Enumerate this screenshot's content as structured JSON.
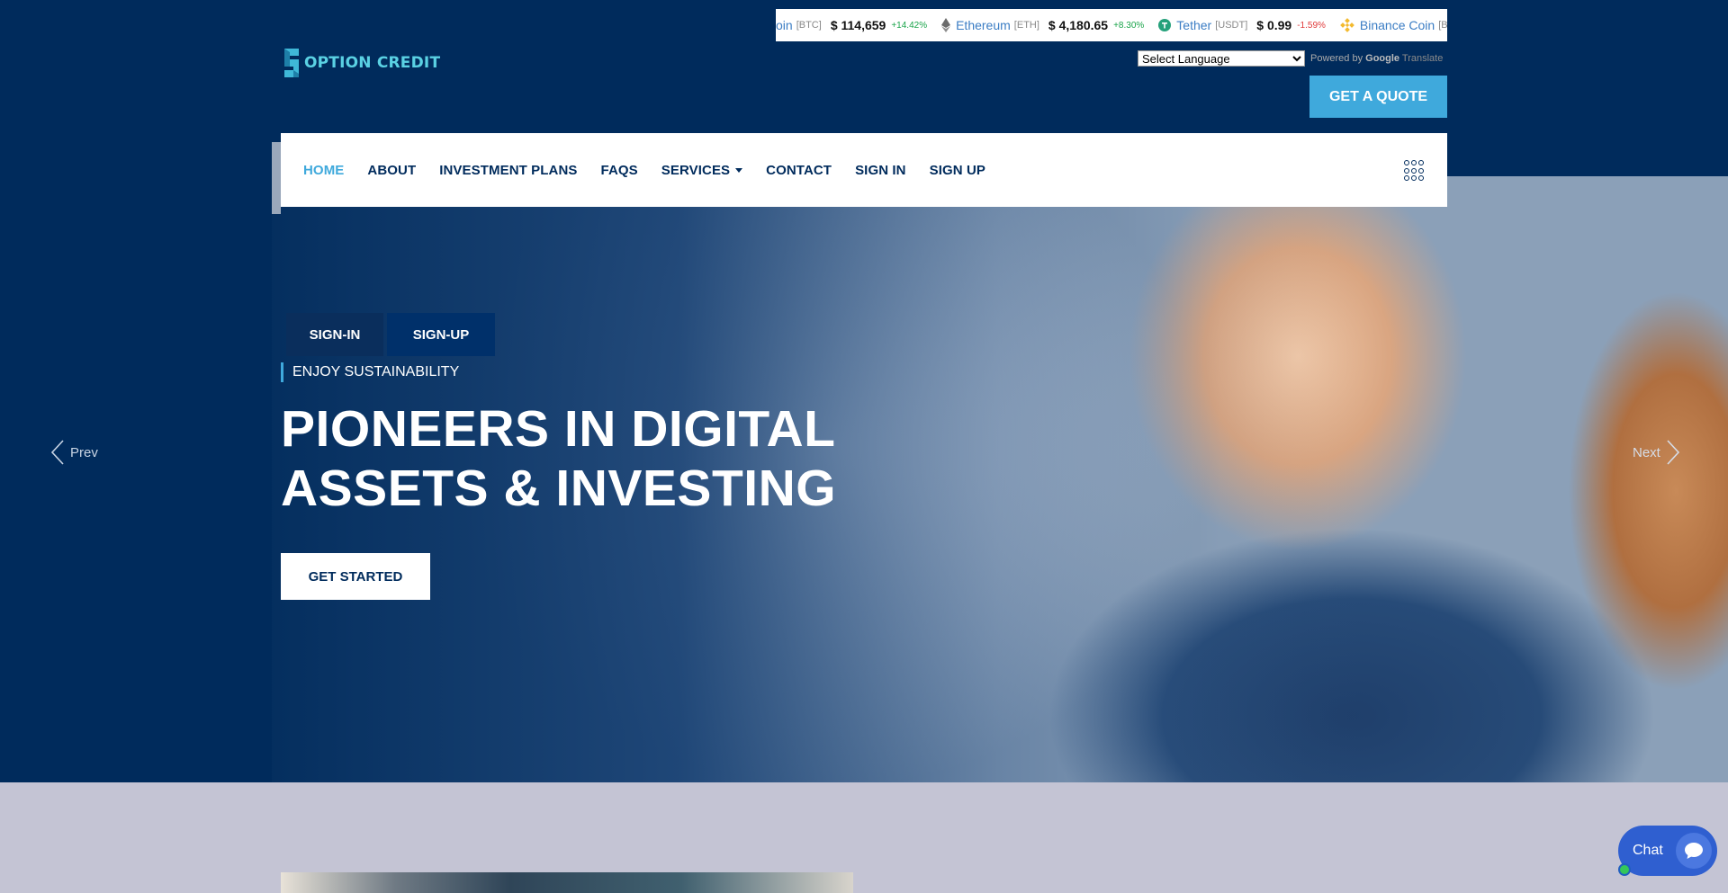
{
  "brand": {
    "name": "OPTION CREDIT",
    "accent": "#3fa9dc",
    "primary": "#002b5c"
  },
  "ticker": [
    {
      "name": "",
      "name_tail": "oin",
      "symbol": "[BTC]",
      "price": "$ 114,659",
      "change": "+14.42%",
      "direction": "up",
      "icon": ""
    },
    {
      "name": "Ethereum",
      "symbol": "[ETH]",
      "price": "$ 4,180.65",
      "change": "+8.30%",
      "direction": "up",
      "icon": "ethereum-icon"
    },
    {
      "name": "Tether",
      "symbol": "[USDT]",
      "price": "$ 0.99",
      "change": "-1.59%",
      "direction": "down",
      "icon": "tether-icon"
    },
    {
      "name": "Binance Coin",
      "symbol": "[BN",
      "icon": "binance-icon"
    }
  ],
  "language": {
    "selected": "Select Language",
    "powered_by": "Powered by",
    "google": "Google",
    "translate": "Translate"
  },
  "header": {
    "quote_button": "GET A QUOTE"
  },
  "nav": {
    "items": [
      {
        "label": "HOME",
        "active": true
      },
      {
        "label": "ABOUT"
      },
      {
        "label": "INVESTMENT PLANS"
      },
      {
        "label": "FAQS"
      },
      {
        "label": "SERVICES",
        "dropdown": true
      },
      {
        "label": "CONTACT"
      },
      {
        "label": "SIGN IN"
      },
      {
        "label": "SIGN UP"
      }
    ]
  },
  "hero": {
    "signin_button": "SIGN-IN",
    "signup_button": "SIGN-UP",
    "tagline": "ENJOY SUSTAINABILITY",
    "headline_line1": "PIONEERS IN DIGITAL",
    "headline_line2": "ASSETS & INVESTING",
    "cta_button": "GET STARTED",
    "prev_label": "Prev",
    "next_label": "Next"
  },
  "chat": {
    "label": "Chat"
  }
}
